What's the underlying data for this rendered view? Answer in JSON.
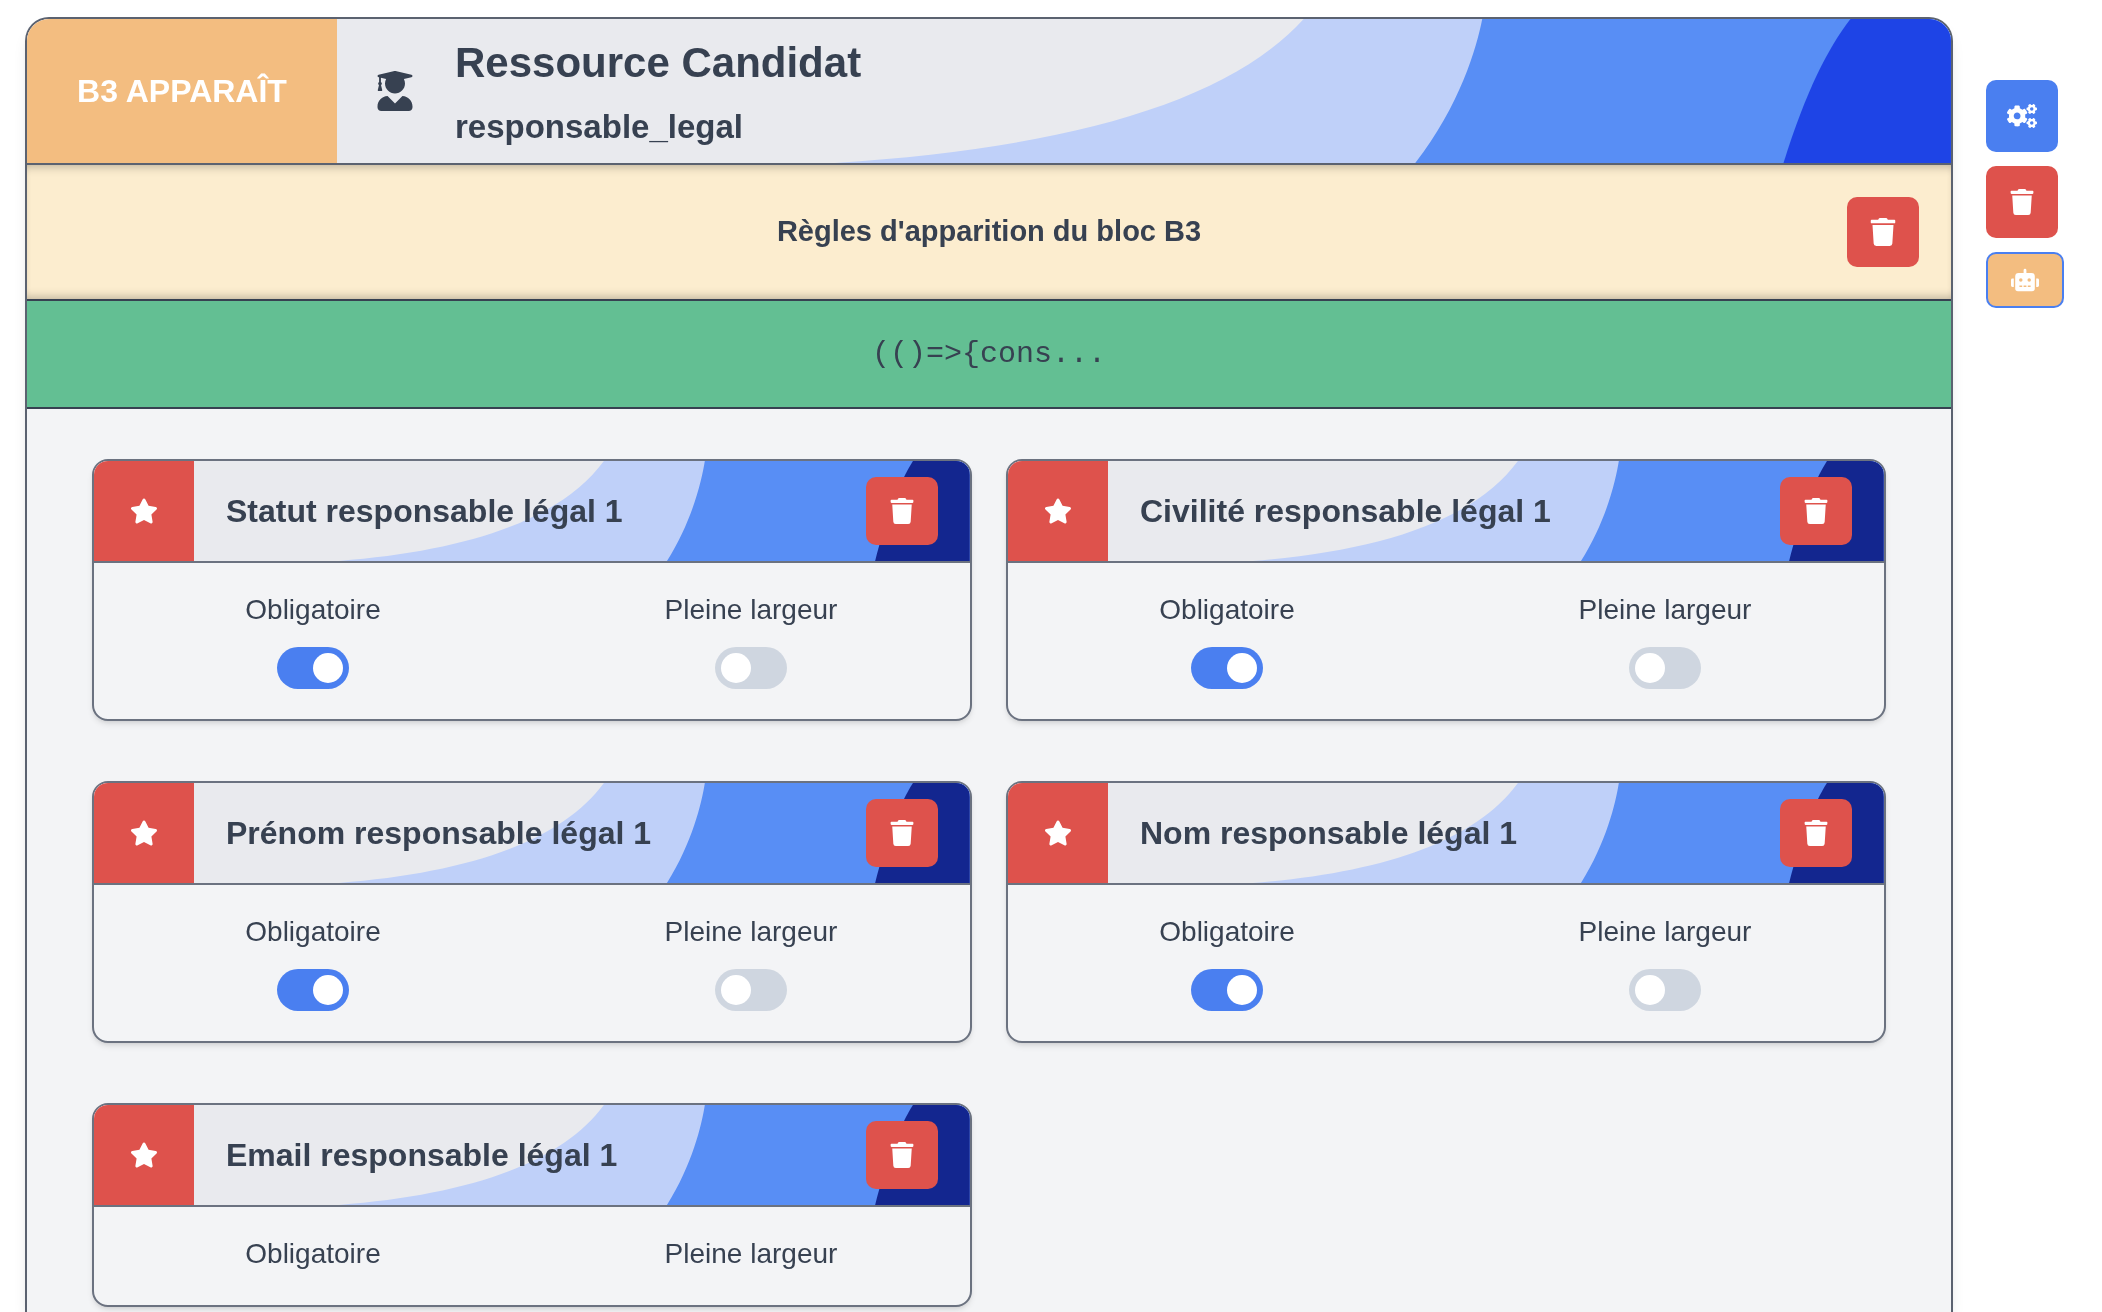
{
  "block": {
    "badge": "B3 APPARAÎT",
    "title": "Ressource Candidat",
    "subtitle": "responsable_legal"
  },
  "rules": {
    "title": "Règles d'apparition du bloc B3"
  },
  "code": {
    "text": "(()=>{cons..."
  },
  "fields": [
    {
      "title": "Statut responsable légal 1",
      "toggles": [
        {
          "label": "Obligatoire",
          "on": true
        },
        {
          "label": "Pleine largeur",
          "on": false
        }
      ]
    },
    {
      "title": "Civilité responsable légal 1",
      "toggles": [
        {
          "label": "Obligatoire",
          "on": true
        },
        {
          "label": "Pleine largeur",
          "on": false
        }
      ]
    },
    {
      "title": "Prénom responsable légal 1",
      "toggles": [
        {
          "label": "Obligatoire",
          "on": true
        },
        {
          "label": "Pleine largeur",
          "on": false
        }
      ]
    },
    {
      "title": "Nom responsable légal 1",
      "toggles": [
        {
          "label": "Obligatoire",
          "on": true
        },
        {
          "label": "Pleine largeur",
          "on": false
        }
      ]
    },
    {
      "title": "Email responsable légal 1",
      "toggles": [
        {
          "label": "Obligatoire"
        },
        {
          "label": "Pleine largeur"
        }
      ]
    }
  ],
  "side_buttons": [
    {
      "kind": "settings"
    },
    {
      "kind": "delete"
    },
    {
      "kind": "robot"
    }
  ]
}
